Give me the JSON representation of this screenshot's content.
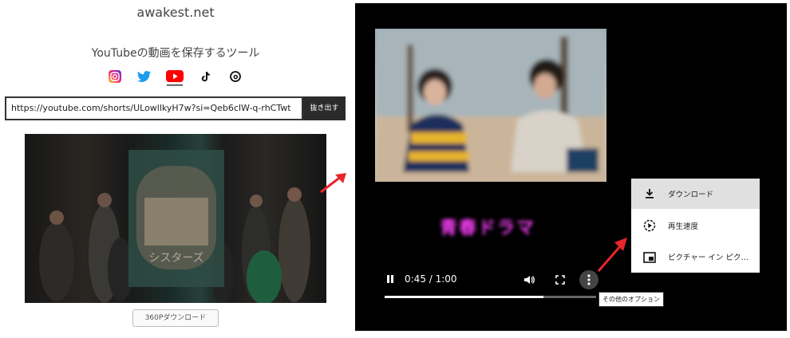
{
  "site": {
    "title": "awakest.net",
    "tool_title": "YouTubeの動画を保存するツール"
  },
  "social_icons": [
    "instagram-icon",
    "twitter-icon",
    "youtube-icon",
    "tiktok-icon",
    "threads-icon"
  ],
  "url_input": {
    "value": "https://youtube.com/shorts/ULowllkyH7w?si=Qeb6clW-q-rhCTwt"
  },
  "extract_button": {
    "label": "抜き出す"
  },
  "download_360": {
    "label": "360Pダウンロード"
  },
  "player": {
    "caption": "青春ドラマ",
    "time_display": "0:45 / 1:00",
    "progress": 0.75,
    "menu": [
      {
        "icon": "download-icon",
        "label": "ダウンロード"
      },
      {
        "icon": "playback-speed-icon",
        "label": "再生速度"
      },
      {
        "icon": "picture-in-picture-icon",
        "label": "ピクチャー イン ピク…"
      }
    ],
    "more_options_tooltip": "その他のオプション"
  },
  "colors": {
    "accent_arrow": "#e8262b",
    "youtube_red": "#ff0000",
    "caption_pink": "#ff40ff"
  }
}
